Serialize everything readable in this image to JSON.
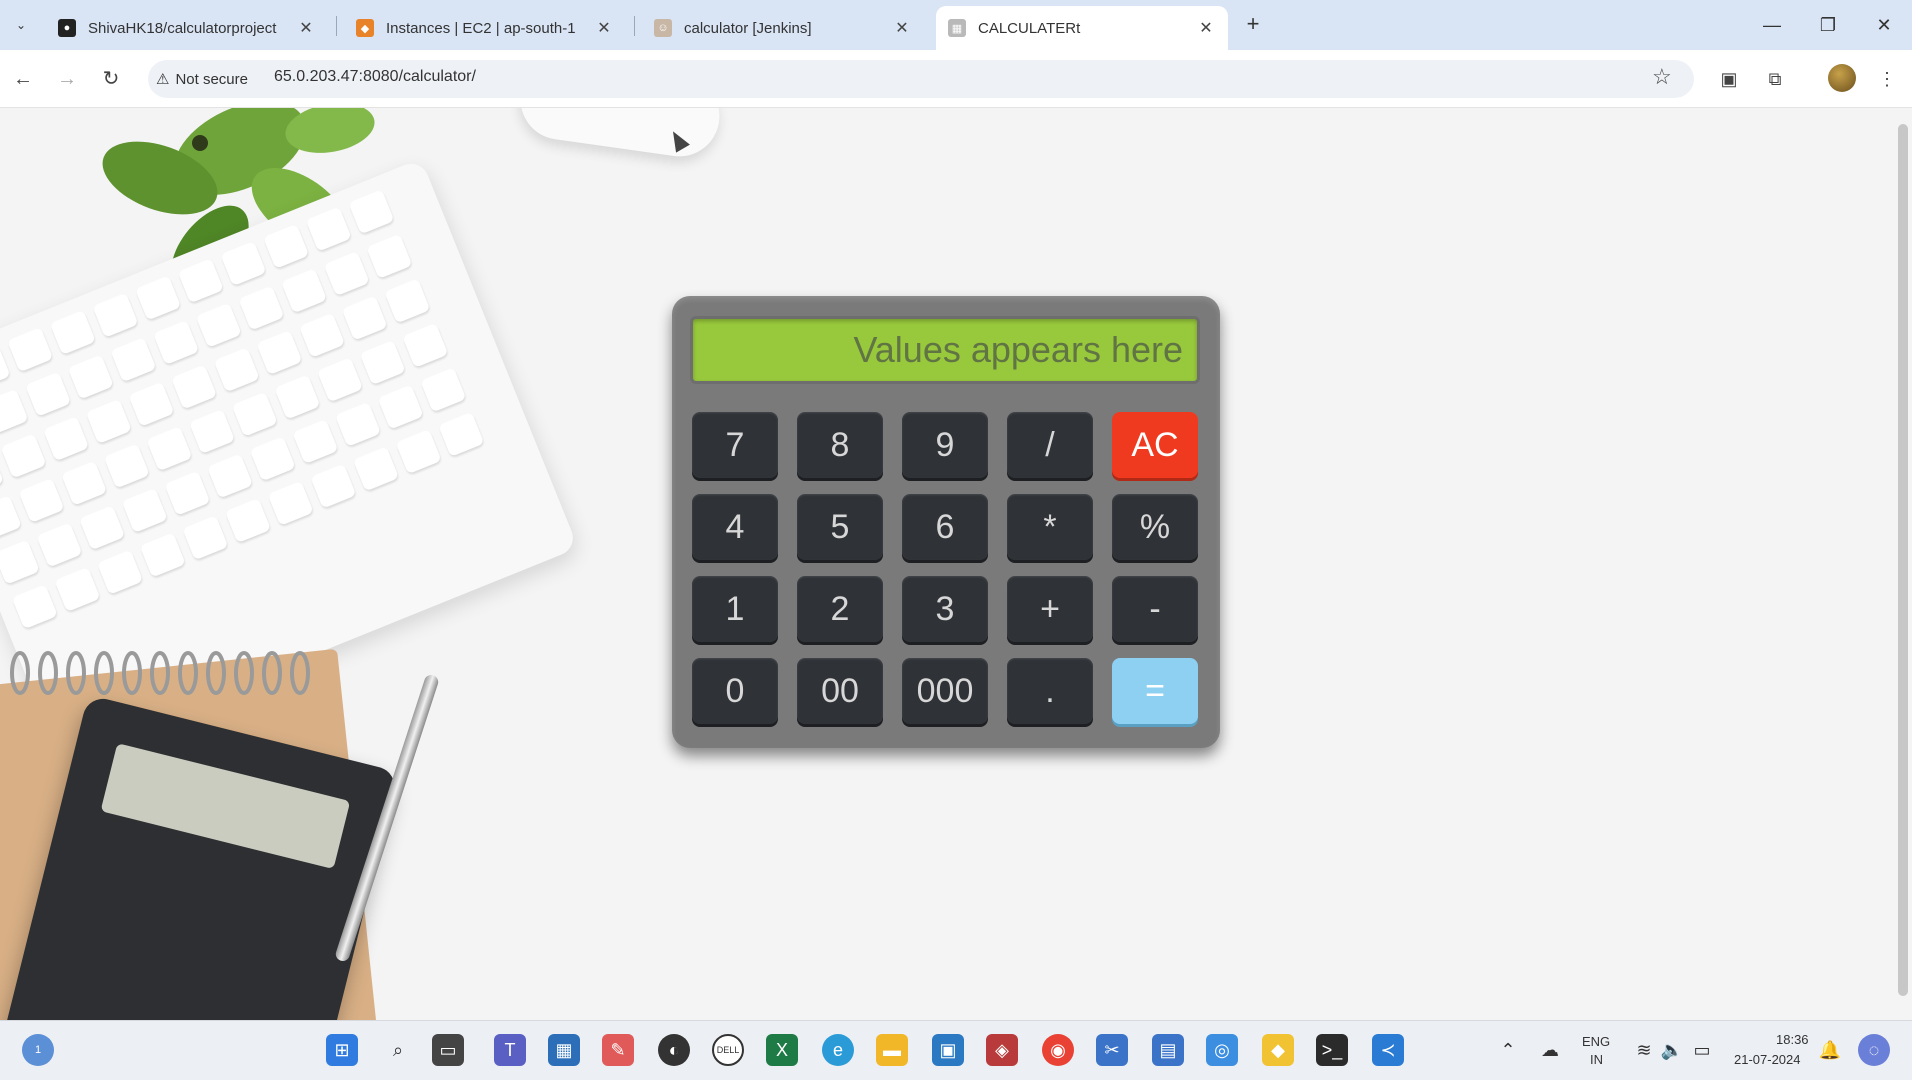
{
  "browser": {
    "tabs": [
      {
        "title": "ShivaHK18/calculatorproject",
        "favicon": "github-icon"
      },
      {
        "title": "Instances | EC2 | ap-south-1",
        "favicon": "aws-icon"
      },
      {
        "title": "calculator [Jenkins]",
        "favicon": "jenkins-icon"
      },
      {
        "title": "CALCULATERt",
        "favicon": "page-icon",
        "active": true
      }
    ],
    "security_label": "Not secure",
    "url": "65.0.203.47:8080/calculator/"
  },
  "calculator": {
    "display_placeholder": "Values appears here",
    "keys": [
      "7",
      "8",
      "9",
      "/",
      "AC",
      "4",
      "5",
      "6",
      "*",
      "%",
      "1",
      "2",
      "3",
      "+",
      "-",
      "0",
      "00",
      "000",
      ".",
      "="
    ],
    "colors": {
      "body": "#7a7a7a",
      "display": "#98c93c",
      "key": "#2f3236",
      "clear": "#f03a1f",
      "equals": "#8ed0f1"
    }
  },
  "taskbar": {
    "language": "ENG",
    "region": "IN",
    "time": "18:36",
    "date": "21-07-2024",
    "notification_count": "1"
  }
}
